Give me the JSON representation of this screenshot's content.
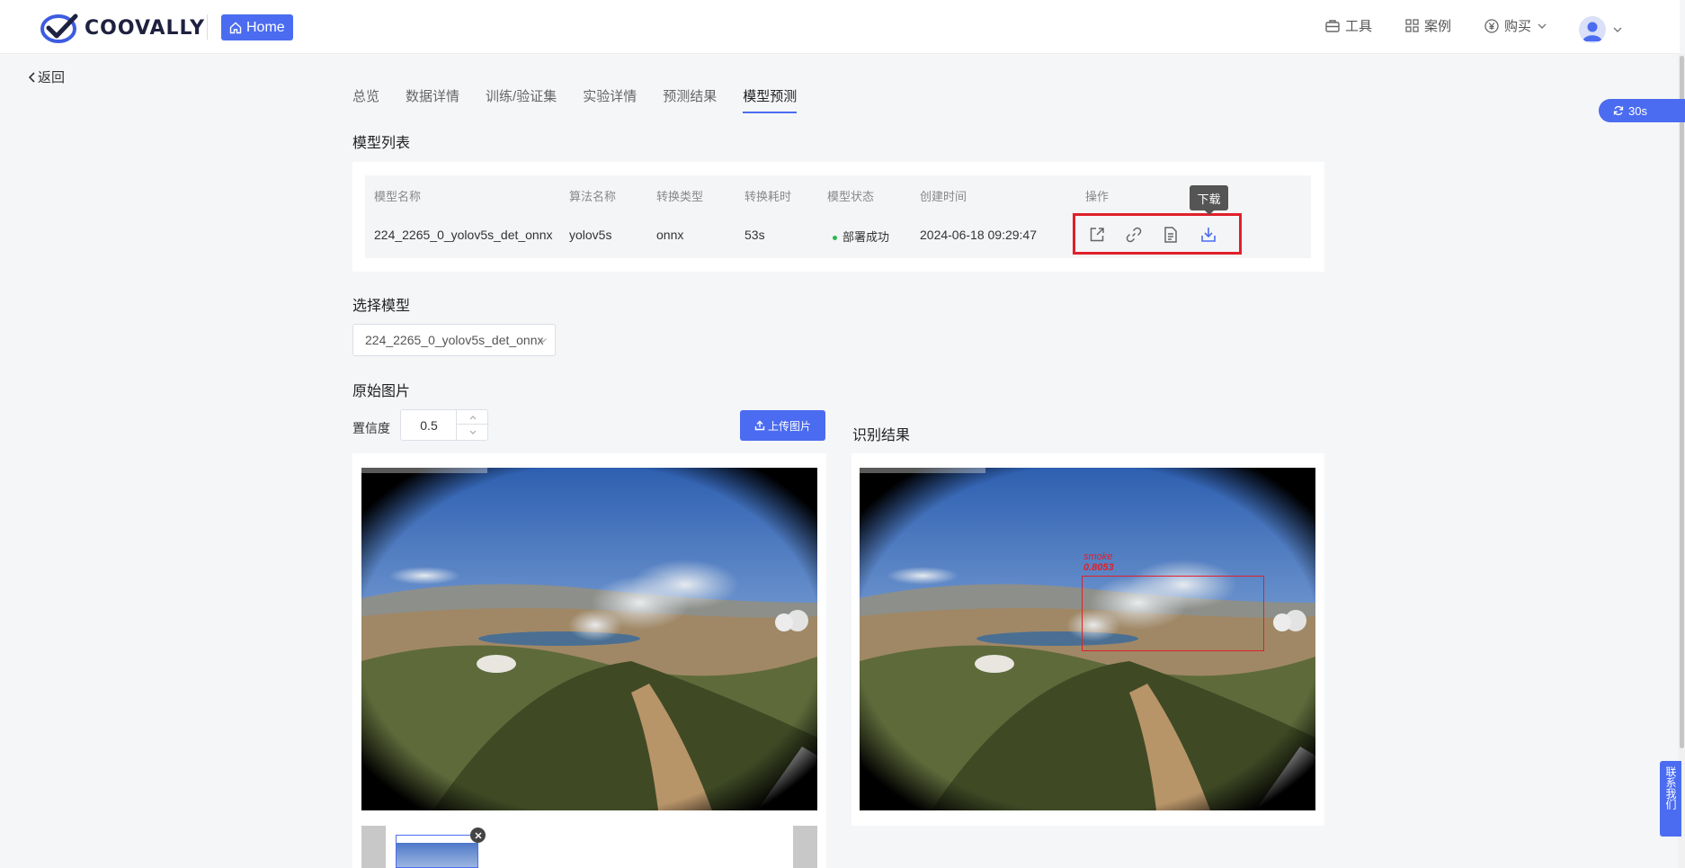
{
  "header": {
    "brand": "COOVALLY",
    "home_label": "Home",
    "nav": {
      "tools": "工具",
      "cases": "案例",
      "buy": "购买"
    }
  },
  "back_label": "返回",
  "tabs": [
    {
      "label": "总览",
      "active": false
    },
    {
      "label": "数据详情",
      "active": false
    },
    {
      "label": "训练/验证集",
      "active": false
    },
    {
      "label": "实验详情",
      "active": false
    },
    {
      "label": "预测结果",
      "active": false
    },
    {
      "label": "模型预测",
      "active": true
    }
  ],
  "model_list": {
    "title": "模型列表",
    "columns": [
      "模型名称",
      "算法名称",
      "转换类型",
      "转换耗时",
      "模型状态",
      "创建时间",
      "操作"
    ],
    "rows": [
      {
        "name": "224_2265_0_yolov5s_det_onnx",
        "algorithm": "yolov5s",
        "convert_type": "onnx",
        "convert_time": "53s",
        "status": "部署成功",
        "created": "2024-06-18 09:29:47",
        "actions": [
          "share-icon",
          "link-icon",
          "document-icon",
          "download-icon"
        ]
      }
    ],
    "tooltip": "下载"
  },
  "select_model": {
    "title": "选择模型",
    "value": "224_2265_0_yolov5s_det_onnx"
  },
  "original_image": {
    "title": "原始图片",
    "confidence_label": "置信度",
    "confidence_value": "0.5",
    "upload_label": "上传图片"
  },
  "result": {
    "title": "识别结果",
    "detection": {
      "class": "smoke",
      "score": "0.8053"
    }
  },
  "refresh_label": "30s",
  "contact_label": "联系我们",
  "colors": {
    "accent": "#4b6cf0",
    "success": "#2bb84f",
    "highlight": "#e0202a"
  }
}
